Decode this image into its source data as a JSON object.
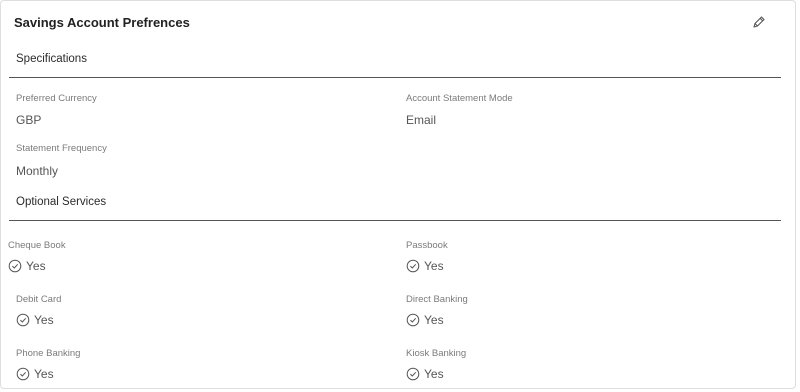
{
  "card": {
    "title": "Savings Account Prefrences",
    "edit_icon": "pencil-icon"
  },
  "specifications": {
    "heading": "Specifications",
    "fields": {
      "preferred_currency": {
        "label": "Preferred Currency",
        "value": "GBP"
      },
      "account_statement_mode": {
        "label": "Account Statement Mode",
        "value": "Email"
      },
      "statement_frequency": {
        "label": "Statement Frequency",
        "value": "Monthly"
      }
    }
  },
  "optional_services": {
    "heading": "Optional Services",
    "check_icon": "check-circle-icon",
    "items": [
      {
        "label": "Cheque Book",
        "value": "Yes"
      },
      {
        "label": "Passbook",
        "value": "Yes"
      },
      {
        "label": "Debit Card",
        "value": "Yes"
      },
      {
        "label": "Direct Banking",
        "value": "Yes"
      },
      {
        "label": "Phone Banking",
        "value": "Yes"
      },
      {
        "label": "Kiosk Banking",
        "value": "Yes"
      }
    ]
  },
  "colors": {
    "text_primary": "#222222",
    "text_label": "#7b7b7b",
    "text_value": "#555555",
    "divider": "#555555",
    "border": "#dedede"
  }
}
